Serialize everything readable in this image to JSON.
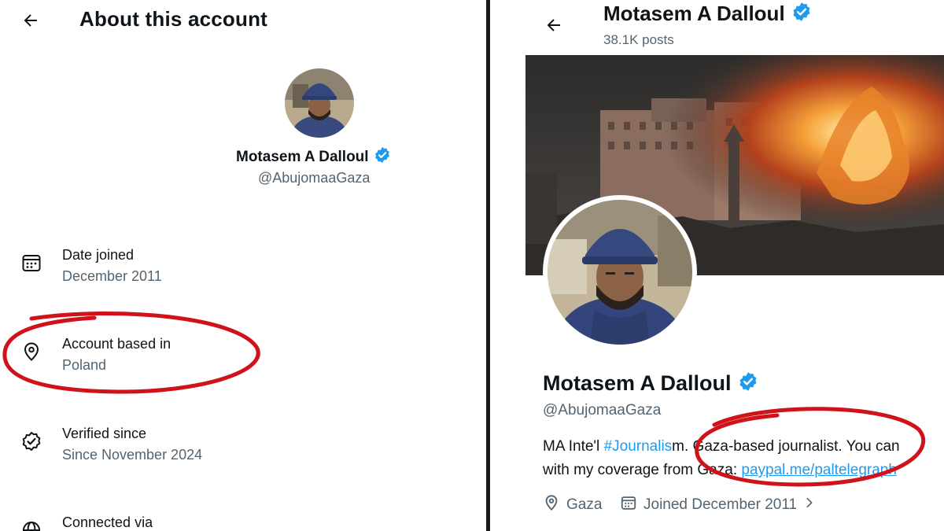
{
  "left": {
    "title": "About this account",
    "profile": {
      "name": "Motasem A Dalloul",
      "handle": "@AbujomaaGaza"
    },
    "rows": [
      {
        "label": "Date joined",
        "value": "December 2011",
        "icon": "calendar-icon"
      },
      {
        "label": "Account based in",
        "value": "Poland",
        "icon": "location-pin-icon"
      },
      {
        "label": "Verified since",
        "value": "Since November 2024",
        "icon": "verified-check-icon"
      },
      {
        "label": "Connected via",
        "value": "",
        "icon": "globe-icon"
      }
    ]
  },
  "right": {
    "header": {
      "title": "Motasem A Dalloul",
      "posts": "38.1K posts"
    },
    "profile": {
      "name": "Motasem A Dalloul",
      "handle": "@AbujomaaGaza",
      "bio": {
        "line1_prefix": "MA Inte'l ",
        "line1_hashtag": "#Journalis",
        "line1_obscured": "m.",
        "line1_rest": " Gaza-based journalist. You can",
        "line2_prefix": "with my coverage from ",
        "line2_obscured": "Gaza: ",
        "line2_link": "paypal.me/paltelegraph"
      },
      "location": "Gaza",
      "joined": "Joined December 2011"
    }
  },
  "colors": {
    "verified_badge": "#1d9bf0",
    "annotation_circle": "#d0121b",
    "secondary_text": "#536471",
    "link": "#1d9bf0"
  }
}
